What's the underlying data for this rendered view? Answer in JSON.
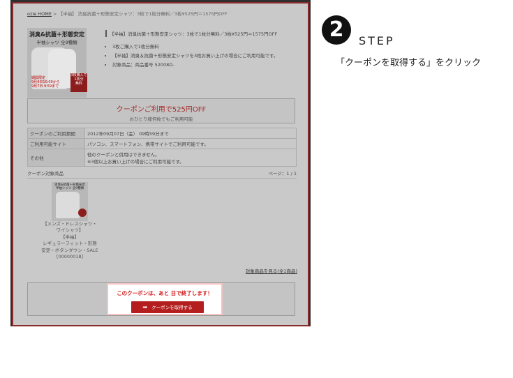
{
  "screenshot": {
    "breadcrumb": {
      "home": "ozie HOME",
      "sep": " > ",
      "current": "【半袖】 消臭抗菌＋形態安定シャツ：3枚で1枚分無料／3枚¥525円＝1575円OFF"
    },
    "product_image": {
      "title": "消臭&抗菌＋形態安定",
      "subtitle": "半袖シャツ 全9種類",
      "sale_text": "期間限定\n9月4日10:00から\n9月7日 9:59まで",
      "badge_text": "3枚購入で\n1枚分\n無料"
    },
    "detail": {
      "title": "【半袖】消臭抗菌＋形態安定シャツ：3枚で1枚分無料／3枚¥525円＝1575円OFF",
      "bullets": [
        "3枚ご購入で1枚分無料",
        "【半袖】消臭＆抗菌＋形態安定シャツを3枚お買い上げの場合にご利用可能です。",
        "対象商品：商品番号 52008D-"
      ]
    },
    "banner": {
      "main": "クーポンご利用で525円OFF",
      "sub": "おひとり様何枚でもご利用可能"
    },
    "info_table": [
      {
        "label": "クーポンのご利用期間",
        "value": "2012年09月07日（金） 09時59分まで"
      },
      {
        "label": "ご利用可能サイト",
        "value": "パソコン、スマートフォン、携帯サイトでご利用可能です。"
      },
      {
        "label": "その他",
        "value": "他のクーポンと併用はできません。\n※3個以上お買い上げの場合にご利用可能です。"
      }
    ],
    "section": {
      "title": "クーポン対象商品",
      "page": "ページ：1 / 1"
    },
    "thumb": {
      "title": "消臭&抗菌＋形態安定\n半袖シャツ 全9種類"
    },
    "product_name": "【メンズ・ドレスシャツ・ワイシャツ】\n【半袖】\nレギュラーフィット・形態安定・ボタンダウン・SALE\n[00000018]",
    "see_all": "対象商品を見る(全1商品)",
    "cta": {
      "notice": "このクーポンは、あと 日で終了します！",
      "button": "クーポンを取得する",
      "arrow": "➡"
    }
  },
  "step": {
    "number": "2",
    "label": "STEP",
    "instruction": "「クーポンを取得する」をクリック"
  },
  "colors": {
    "accent": "#b41e1e",
    "frame_border": "#8a2a2a",
    "highlight_border": "#f4c2c2",
    "dark_band": "#2f2f2f"
  }
}
